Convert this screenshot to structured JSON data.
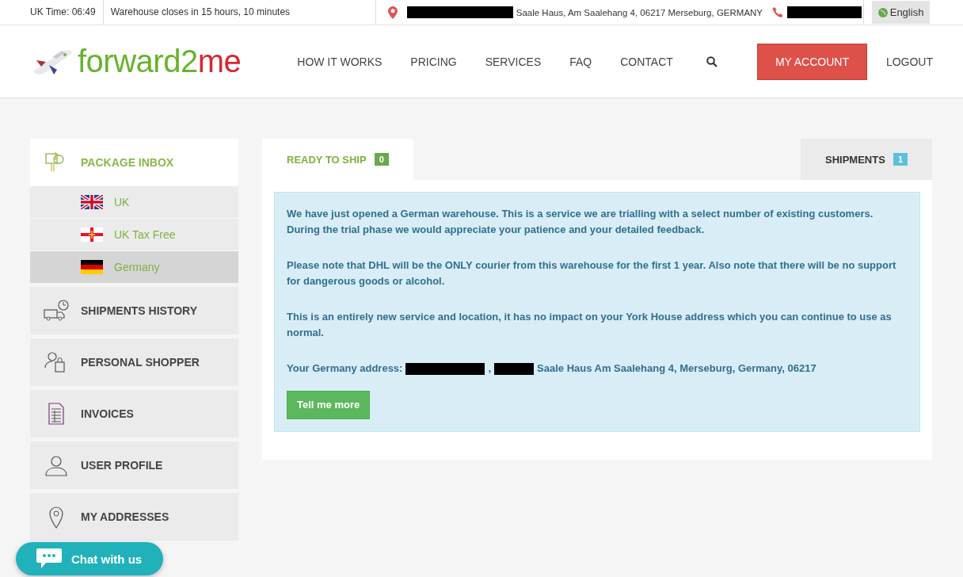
{
  "topbar": {
    "time": "UK Time: 06:49",
    "closing": "Warehouse closes in 15 hours, 10 minutes",
    "address": "Saale Haus, Am Saalehang 4, 06217 Merseburg, GERMANY",
    "language": "English"
  },
  "logo": {
    "main": "forward2",
    "accent": "me"
  },
  "nav": [
    "HOW IT WORKS",
    "PRICING",
    "SERVICES",
    "FAQ",
    "CONTACT"
  ],
  "account_button": "MY ACCOUNT",
  "logout": "LOGOUT",
  "sidebar": [
    {
      "label": "PACKAGE INBOX",
      "kind": "inbox",
      "active": true,
      "children": [
        {
          "label": "UK",
          "kind": "uk",
          "selected": false
        },
        {
          "label": "UK Tax Free",
          "kind": "guernsey",
          "selected": false
        },
        {
          "label": "Germany",
          "kind": "germany",
          "selected": true
        }
      ]
    },
    {
      "label": "SHIPMENTS HISTORY",
      "kind": "history",
      "active": false
    },
    {
      "label": "PERSONAL SHOPPER",
      "kind": "shopper",
      "active": false
    },
    {
      "label": "INVOICES",
      "kind": "invoices",
      "active": false
    },
    {
      "label": "USER PROFILE",
      "kind": "profile",
      "active": false
    },
    {
      "label": "MY ADDRESSES",
      "kind": "addresses",
      "active": false
    }
  ],
  "tabs": [
    {
      "label": "READY TO SHIP",
      "count": "0",
      "selected": true
    },
    {
      "label": "SHIPMENTS",
      "count": "1",
      "selected": false
    }
  ],
  "notice": {
    "paragraphs": [
      "We have just opened a German warehouse. This is a service we are trialling with a select number of existing customers. During the trial phase we would appreciate your patience and your detailed feedback.",
      "Please note that DHL will be the ONLY courier from this warehouse for the first 1 year. Also note that there will be no support for dangerous goods or alcohol.",
      "This is an entirely new service and location, it has no impact on your York House address which you can continue to use as normal."
    ],
    "address_label": "Your Germany address:",
    "address_separator": ",",
    "address_rest": "Saale Haus Am Saalehang 4, Merseburg, Germany, 06217",
    "button": "Tell me more"
  },
  "chat": "Chat with us"
}
